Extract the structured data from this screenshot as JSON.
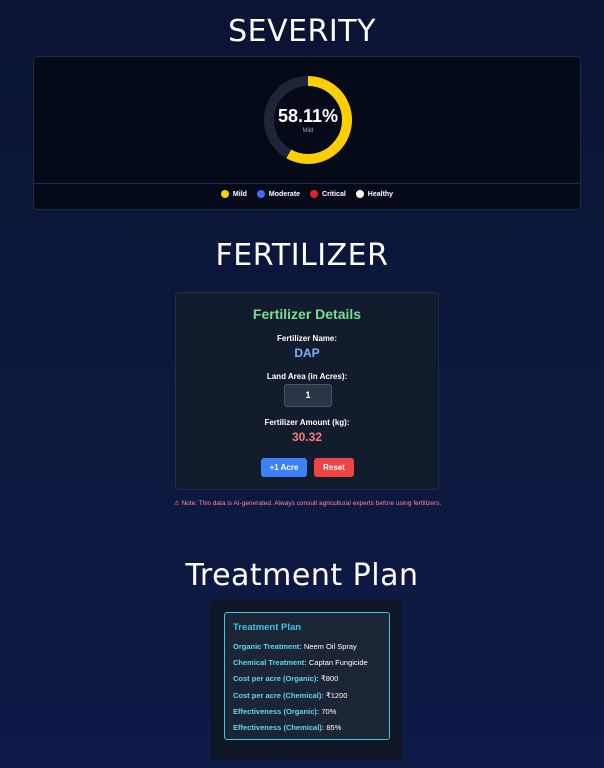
{
  "sections": {
    "severity_title": "SEVERITY",
    "fertilizer_title": "FERTILIZER",
    "treatment_title": "Treatment Plan"
  },
  "severity": {
    "percent_text": "58.11%",
    "percent_value": 58.11,
    "level_label": "Mild",
    "colors": {
      "mild": "#fcd000",
      "track": "#1e2538"
    },
    "legend": [
      {
        "label": "Mild",
        "color": "#fcd000"
      },
      {
        "label": "Moderate",
        "color": "#3b6cf5"
      },
      {
        "label": "Critical",
        "color": "#e02424"
      },
      {
        "label": "Healthy",
        "color": "#ffffff"
      }
    ]
  },
  "fertilizer": {
    "heading": "Fertilizer Details",
    "name_label": "Fertilizer Name:",
    "name_value": "DAP",
    "area_label": "Land Area (in Acres):",
    "area_value": "1",
    "amount_label": "Fertilizer Amount (kg):",
    "amount_value": "30.32",
    "add_button": "+1 Acre",
    "reset_button": "Reset",
    "note_icon": "warning-icon",
    "note": "Note: This data is AI-generated. Always consult agricultural experts before using fertilizers."
  },
  "treatment": {
    "heading": "Treatment Plan",
    "rows": [
      {
        "key": "Organic Treatment:",
        "value": "Neem Oil Spray"
      },
      {
        "key": "Chemical Treatment:",
        "value": "Captan Fungicide"
      },
      {
        "key": "Cost per acre (Organic):",
        "value": "₹800"
      },
      {
        "key": "Cost per acre (Chemical):",
        "value": "₹1200"
      },
      {
        "key": "Effectiveness (Organic):",
        "value": "70%"
      },
      {
        "key": "Effectiveness (Chemical):",
        "value": "85%"
      }
    ]
  }
}
